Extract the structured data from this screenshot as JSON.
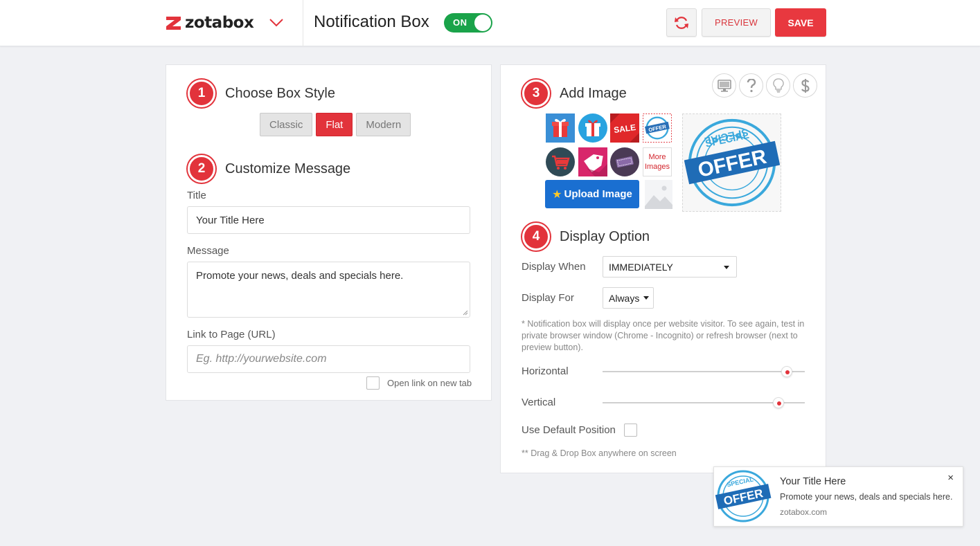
{
  "header": {
    "logo_text": "zotabox",
    "app_title": "Notification Box",
    "toggle_label": "ON",
    "preview_label": "PREVIEW",
    "save_label": "SAVE"
  },
  "left_panel": {
    "step1": {
      "number": "1",
      "title": "Choose Box Style"
    },
    "styles": [
      {
        "label": "Classic",
        "active": false
      },
      {
        "label": "Flat",
        "active": true
      },
      {
        "label": "Modern",
        "active": false
      }
    ],
    "step2": {
      "number": "2",
      "title": "Customize Message"
    },
    "title_label": "Title",
    "title_value": "Your Title Here",
    "message_label": "Message",
    "message_value": "Promote your news, deals and specials here.",
    "link_label": "Link to Page (URL)",
    "link_placeholder": "Eg. http://yourwebsite.com",
    "new_tab_label": "Open link on new tab"
  },
  "right_panel": {
    "step3": {
      "number": "3",
      "title": "Add Image"
    },
    "more_images_label": "More Images",
    "upload_label": "Upload Image",
    "sale_text": "SALE",
    "offer_text": "OFFER",
    "special_text": "SPECIAL",
    "step4": {
      "number": "4",
      "title": "Display Option"
    },
    "display_when_label": "Display When",
    "display_when_value": "IMMEDIATELY",
    "display_for_label": "Display For",
    "display_for_value": "Always",
    "note": "* Notification box will display once per website visitor. To see again, test in private browser window (Chrome - Incognito) or refresh browser (next to preview button).",
    "horizontal_label": "Horizontal",
    "horizontal_level": 0.91,
    "vertical_label": "Vertical",
    "vertical_level": 0.87,
    "default_position_label": "Use Default Position",
    "drag_note": "** Drag & Drop Box anywhere on screen"
  },
  "notification_preview": {
    "title": "Your Title Here",
    "message": "Promote your news, deals and specials here.",
    "link": "zotabox.com",
    "close": "×"
  },
  "colors": {
    "accent_red": "#e2333b",
    "toggle_green": "#1aa34a",
    "upload_blue": "#1a6fd1"
  }
}
